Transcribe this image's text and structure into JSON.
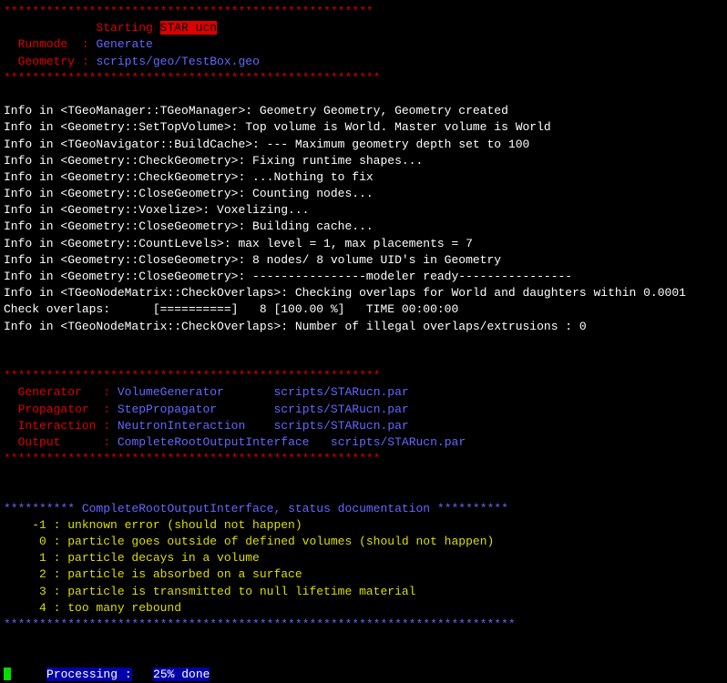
{
  "header": {
    "stars_top": "****************************************************",
    "starting_label": "Starting",
    "starting_app": "STAR ucn",
    "runmode_label": "Runmode  ",
    "runmode_sep": ": ",
    "runmode_value": "Generate",
    "geometry_label": "Geometry ",
    "geometry_sep": ": ",
    "geometry_value": "scripts/geo/TestBox.geo",
    "stars_bottom": "*****************************************************"
  },
  "info_lines": [
    "Info in <TGeoManager::TGeoManager>: Geometry Geometry, Geometry created",
    "Info in <Geometry::SetTopVolume>: Top volume is World. Master volume is World",
    "Info in <TGeoNavigator::BuildCache>: --- Maximum geometry depth set to 100",
    "Info in <Geometry::CheckGeometry>: Fixing runtime shapes...",
    "Info in <Geometry::CheckGeometry>: ...Nothing to fix",
    "Info in <Geometry::CloseGeometry>: Counting nodes...",
    "Info in <Geometry::Voxelize>: Voxelizing...",
    "Info in <Geometry::CloseGeometry>: Building cache...",
    "Info in <Geometry::CountLevels>: max level = 1, max placements = 7",
    "Info in <Geometry::CloseGeometry>: 8 nodes/ 8 volume UID's in Geometry",
    "Info in <Geometry::CloseGeometry>: ----------------modeler ready----------------",
    "Info in <TGeoNodeMatrix::CheckOverlaps>: Checking overlaps for World and daughters within 0.0001",
    "Check overlaps:      [==========]   8 [100.00 %]   TIME 00:00:00",
    "Info in <TGeoNodeMatrix::CheckOverlaps>: Number of illegal overlaps/extrusions : 0"
  ],
  "config": {
    "stars_top": "*****************************************************",
    "generator_label": "Generator   ",
    "sep": ": ",
    "generator_value": "VolumeGenerator",
    "generator_path": "scripts/STARucn.par",
    "propagator_label": "Propagator  ",
    "propagator_value": "StepPropagator",
    "propagator_path": "scripts/STARucn.par",
    "interaction_label": "Interaction ",
    "interaction_value": "NeutronInteraction",
    "interaction_path": "scripts/STARucn.par",
    "output_label": "Output      ",
    "output_value": "CompleteRootOutputInterface",
    "output_path": "scripts/STARucn.par",
    "stars_bottom": "*****************************************************"
  },
  "status_doc": {
    "header_stars_left": "********** ",
    "header_text": "CompleteRootOutputInterface, status documentation",
    "header_stars_right": " **********",
    "codes": [
      {
        "code": "    -1 ",
        "sep": ": ",
        "desc": "unknown error (should not happen)"
      },
      {
        "code": "     0 ",
        "sep": ": ",
        "desc": "particle goes outside of defined volumes (should not happen)"
      },
      {
        "code": "     1 ",
        "sep": ": ",
        "desc": "particle decays in a volume"
      },
      {
        "code": "     2 ",
        "sep": ": ",
        "desc": "particle is absorbed on a surface"
      },
      {
        "code": "     3 ",
        "sep": ": ",
        "desc": "particle is transmitted to null lifetime material"
      },
      {
        "code": "     4 ",
        "sep": ": ",
        "desc": "too many rebound"
      }
    ],
    "stars_bottom": "************************************************************************"
  },
  "progress": {
    "label": "Processing :",
    "value": "25% done"
  }
}
